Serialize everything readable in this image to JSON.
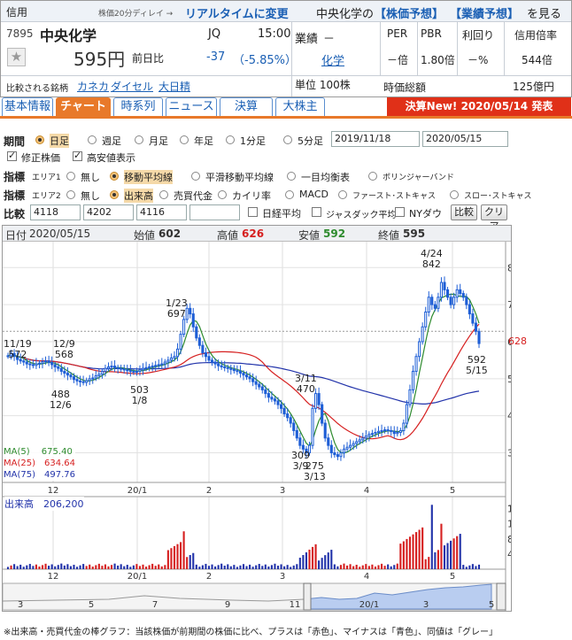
{
  "header": {
    "category": "信用",
    "delay_note": "株価20分ディレイ →",
    "realtime_link": "リアルタイムに変更",
    "prompt_pre": "中央化学の",
    "forecast_stock": "【株価予想】",
    "forecast_earnings": "【業績予想】",
    "prompt_post": "を見る",
    "code": "7895",
    "name": "中央化学",
    "market": "JQ",
    "time": "15:00",
    "price": "595円",
    "change_label": "前日比",
    "change": "-37",
    "change_pct": "（-5.85%）",
    "compare_label": "比較される銘柄",
    "compare_1": "カネカ",
    "compare_2": "ダイセル",
    "compare_3": "大日精",
    "industry_label": "業績",
    "industry_dash": "－",
    "industry_link": "化学",
    "unit": "単位 100株",
    "per_label": "PER",
    "pbr_label": "PBR",
    "yield_label": "利回り",
    "margin_label": "信用倍率",
    "per_val": "－倍",
    "pbr_val": "1.80倍",
    "yield_val": "－%",
    "margin_val": "544倍",
    "mcap_label": "時価総額",
    "mcap_val": "125億円"
  },
  "tabs": [
    "基本情報",
    "チャート",
    "時系列",
    "ニュース",
    "決算",
    "大株主"
  ],
  "banner": "決算New! 2020/05/14 発表",
  "controls": {
    "period_label": "期間",
    "periods": [
      "日足",
      "週足",
      "月足",
      "年足",
      "1分足",
      "5分足"
    ],
    "date_from": "2019/11/18",
    "date_to": "2020/05/15",
    "adjusted": "修正株価",
    "highlow": "高安値表示",
    "ind_label": "指標",
    "area1": "エリア1",
    "area1_opts": [
      "無し",
      "移動平均線",
      "平滑移動平均線",
      "一目均衡表",
      "ボリンジャーバンド"
    ],
    "area2": "エリア2",
    "area2_opts": [
      "無し",
      "出来高",
      "売買代金",
      "カイリ率",
      "MACD",
      "ファースト･ストキャス",
      "スロー･ストキャス"
    ],
    "cmp_label": "比較",
    "codes": [
      "4118",
      "4202",
      "4116",
      ""
    ],
    "nikkei": "日経平均",
    "jasdaq": "ジャスダック平均",
    "nydow": "NYダウ",
    "cmp_btn": "比較",
    "clear_btn": "クリア"
  },
  "chart_info": {
    "date_label": "日付",
    "date": "2020/05/15",
    "open_label": "始値",
    "open": "602",
    "high_label": "高値",
    "high": "626",
    "low_label": "安値",
    "low": "592",
    "close_label": "終値",
    "close": "595"
  },
  "ma_legend": [
    "MA(5)　 675.40",
    "MA(25)　634.64",
    "MA(75)　497.76"
  ],
  "volume_label": "出来高　206,200",
  "footnote": "※出来高・売買代金の棒グラフ：当該株価が前期間の株価に比べ、プラスは「赤色」、マイナスは「青色」、同値は「グレー」",
  "annotations": {
    "a1": "11/19",
    "a1v": "572",
    "a2": "12/9",
    "a2v": "568",
    "a3v": "488",
    "a3": "12/6",
    "a4v": "503",
    "a4": "1/8",
    "a5": "1/23",
    "a5v": "697",
    "a6": "3/11",
    "a6v": "470",
    "a7v": "309",
    "a7": "3/9",
    "a8v": "275",
    "a8": "3/13",
    "a9": "4/24",
    "a9v": "842",
    "a10v": "592",
    "a10": "5/15",
    "last": "628"
  },
  "chart_data": {
    "type": "candlestick",
    "y_ticks": [
      300,
      400,
      500,
      600,
      700,
      800
    ],
    "x_ticks": [
      "12",
      "20/1",
      "2",
      "3",
      "4",
      "5"
    ],
    "vol_ticks": [
      400,
      800,
      1200,
      1600
    ],
    "navigator_ticks": [
      "3",
      "5",
      "7",
      "9",
      "11",
      "20/1",
      "3",
      "5"
    ],
    "ylim": [
      220,
      870
    ],
    "colors": {
      "up": "#1f5fd6",
      "down": "#1f5fd6",
      "ma5": "#2e8b2e",
      "ma25": "#d62020",
      "ma75": "#2233aa",
      "vol_up": "#d62020",
      "vol_down": "#2233aa"
    }
  }
}
